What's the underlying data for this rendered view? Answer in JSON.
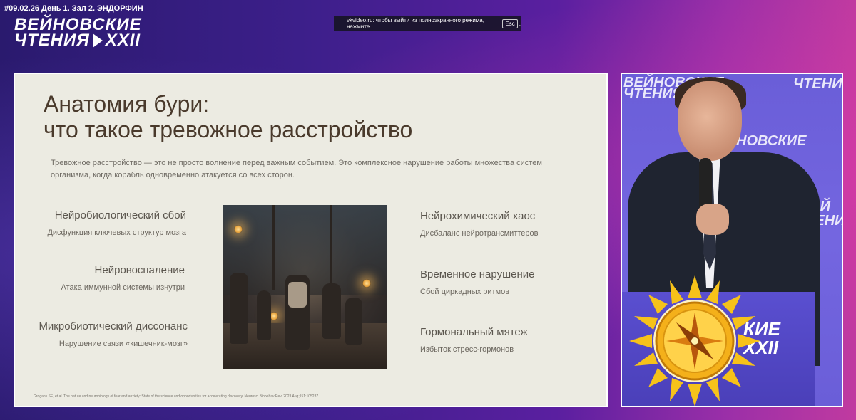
{
  "player": {
    "caption": "#09.02.26 День 1. Зал 2. ЭНДОРФИН",
    "brand_line1": "ВЕЙНОВСКИЕ",
    "brand_line2": "ЧТЕНИЯ",
    "brand_roman": "XXII",
    "toast_text": "vkvideo.ru: чтобы выйти из полноэкранного режима, нажмите",
    "toast_key": "Esc",
    "toast_tail": "."
  },
  "slide": {
    "title_line1": "Анатомия бури:",
    "title_line2": "что такое тревожное расстройство",
    "intro": "Тревожное расстройство — это не просто волнение перед важным событием. Это комплексное нарушение работы множества систем организма, когда корабль одновременно атакуется со всех сторон.",
    "left_items": [
      {
        "heading": "Нейробиологический сбой",
        "sub": "Дисфункция ключевых структур мозга"
      },
      {
        "heading": "Нейровоспаление",
        "sub": "Атака иммунной системы изнутри"
      },
      {
        "heading": "Микробиотический диссонанс",
        "sub": "Нарушение связи «кишечник-мозг»"
      }
    ],
    "right_items": [
      {
        "heading": "Нейрохимический хаос",
        "sub": "Дисбаланс нейротрансмиттеров"
      },
      {
        "heading": "Временное нарушение",
        "sub": "Сбой циркадных ритмов"
      },
      {
        "heading": "Гормональный мятеж",
        "sub": "Избыток стресс-гормонов"
      }
    ],
    "footnote": "Grogans SE, et al. The nature and neurobiology of fear and anxiety: State of the science and opportunities for accelerating discovery. Neurosci Biobehav Rev. 2023 Aug;151:105237."
  },
  "camera": {
    "bg_text_1": "ВЕЙНОВСКИЕ",
    "bg_text_2": "ЧТЕНИЯ",
    "bg_text_3": "НОВСКИЕ",
    "bg_text_4": "ЧТЕНИЯ",
    "bg_text_5": "ВЕЙ",
    "bg_text_6": "ЧТЕНИ",
    "podium_text_1": "КИЕ",
    "podium_text_2": "XXII"
  },
  "colors": {
    "slide_bg": "#ecebe2",
    "title": "#4a3a2c",
    "accent_sun": "#f2b705"
  }
}
